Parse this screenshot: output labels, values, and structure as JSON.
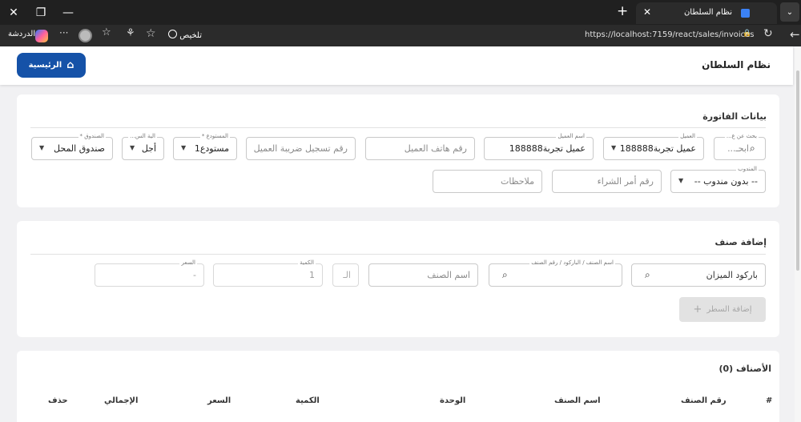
{
  "browser": {
    "tab_title": "نظام السلطان",
    "url": "https://localhost:7159/react/sales/invoices",
    "summarize_label": "تلخيص",
    "chat_label": "الدردشة",
    "win_close": "✕",
    "win_restore": "❐",
    "win_minimize": "—",
    "new_tab": "+",
    "tab_close": "✕",
    "tab_menu": "⌄",
    "back": "←",
    "refresh": "↻",
    "lock": "🔒",
    "star": "☆",
    "favorites": "☆",
    "extensions": "⚘",
    "more": "···"
  },
  "header": {
    "app_title": "نظام السلطان",
    "home_label": "الرئيسية",
    "home_icon": "⌂"
  },
  "invoice": {
    "title": "بيانات الفاتورة",
    "search_label": "بحث عن ع...",
    "search_placeholder": "ابحـ...",
    "customer_label": "العميل",
    "customer_value": "عميل تجربة188888",
    "customer_name_label": "اسم العميل",
    "customer_name_value": "عميل تجربة188888",
    "phone_placeholder": "رقم هاتف العميل",
    "tax_placeholder": "رقم تسجيل ضريبة العميل",
    "warehouse_label": "المستودع *",
    "warehouse_value": "مستودع1",
    "payment_label": "الية الس...",
    "payment_value": "أجل",
    "cashbox_label": "الصندوق *",
    "cashbox_value": "صندوق المحل",
    "rep_label": "المندوب",
    "rep_value": "-- بدون مندوب --",
    "po_placeholder": "رقم أمر الشراء",
    "notes_placeholder": "ملاحظات",
    "dropdown_icon": "▼",
    "search_icon": "🔍"
  },
  "add_item": {
    "title": "إضافة صنف",
    "barcode_placeholder": "باركود الميزان",
    "item_search_label": "اسم الصنف / الباركود / رقم الصنف",
    "item_name_placeholder": "اسم الصنف",
    "unit_placeholder": "الـ",
    "qty_label": "الكمية",
    "qty_value": "1",
    "price_label": "السعر",
    "price_value": "-",
    "add_button": "إضافة السطر",
    "add_icon": "+"
  },
  "items": {
    "title": "الأصناف (0)",
    "columns": [
      "#",
      "رقم الصنف",
      "اسم الصنف",
      "الوحدة",
      "الكمية",
      "السعر",
      "الإجمالي",
      "حذف"
    ]
  }
}
